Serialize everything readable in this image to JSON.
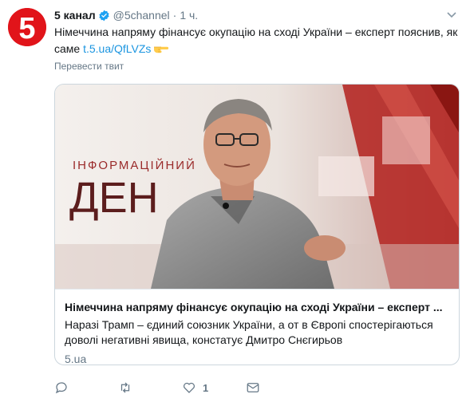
{
  "tweet": {
    "author_name": "5 канал",
    "handle": "@5channel",
    "separator": "·",
    "time": "1 ч.",
    "text": "Німеччина напряму фінансує окупацію на сході України – експерт пояснив, як саме ",
    "link_text": "t.5.ua/QfLVZs",
    "translate_label": "Перевести твит"
  },
  "avatar": {
    "glyph": "5",
    "color": "#e1141a"
  },
  "card": {
    "image_caption_line1": "ІНФОРМАЦІЙНИЙ",
    "image_caption_line2": "ДЕН",
    "title": "Німеччина напряму фінансує окупацію на сході України – експерт ...",
    "description": "Наразі Трамп – єдиний союзник України, а от в Європі спостерігаються доволі негативні явища, констатує Дмитро Снєгирьов",
    "domain": "5.ua"
  },
  "actions": {
    "reply_count": "",
    "retweet_count": "",
    "like_count": "1",
    "dm_count": ""
  },
  "colors": {
    "link": "#1b95e0",
    "muted": "#657786",
    "verified": "#1da1f2"
  },
  "icons": [
    "verified-icon",
    "chevron-down-icon",
    "pointing-hand-icon",
    "reply-icon",
    "retweet-icon",
    "like-icon",
    "message-icon"
  ]
}
